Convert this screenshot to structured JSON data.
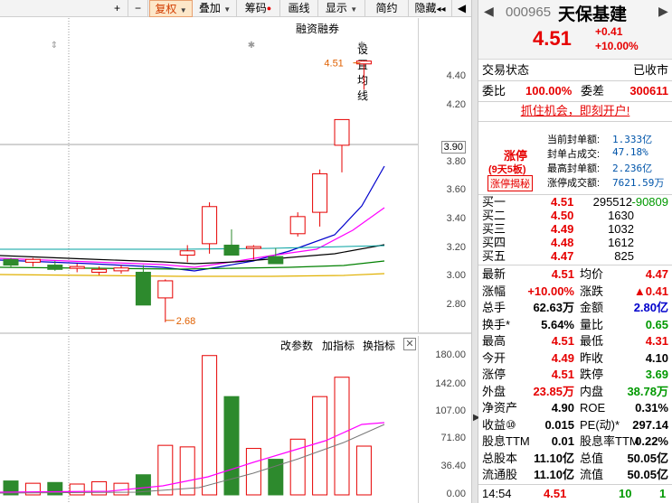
{
  "toolbar": {
    "plus": "+",
    "minus": "−",
    "fuquan": "复权",
    "diejia": "叠加",
    "chouma": "筹码",
    "huaxian": "画线",
    "xianshi": "显示",
    "jianyue": "简约",
    "yincang": "隐藏",
    "collapse": "◂◂",
    "nav": "◀"
  },
  "chart": {
    "link_rzrq": "融资融券",
    "link_setma": "设置均线",
    "price_labels": [
      "4.40",
      "4.20",
      "3.80",
      "3.60",
      "3.40",
      "3.20",
      "3.00",
      "2.80"
    ],
    "current_price_label": "3.90",
    "high_annotation": "4.51",
    "low_annotation": "2.68",
    "vol_links": {
      "params": "改参数",
      "add": "加指标",
      "switch": "换指标",
      "close": "✕"
    },
    "vol_labels": [
      "180.00",
      "142.00",
      "107.00",
      "71.80",
      "36.40",
      "0.00"
    ],
    "colors": {
      "up": "#e60000",
      "down": "#2d8a2d",
      "ma5": "#000000",
      "ma10": "#e0b000",
      "ma20": "#ff00ff",
      "ma30": "#008000",
      "ma60": "#0000cc"
    }
  },
  "chart_data": {
    "type": "candlestick",
    "candles": [
      {
        "o": 3.12,
        "h": 3.13,
        "l": 3.06,
        "c": 3.08,
        "v": 18
      },
      {
        "o": 3.1,
        "h": 3.13,
        "l": 3.07,
        "c": 3.12,
        "v": 15
      },
      {
        "o": 3.08,
        "h": 3.11,
        "l": 3.04,
        "c": 3.05,
        "v": 16
      },
      {
        "o": 3.06,
        "h": 3.09,
        "l": 3.03,
        "c": 3.07,
        "v": 14
      },
      {
        "o": 3.03,
        "h": 3.07,
        "l": 3.01,
        "c": 3.05,
        "v": 17
      },
      {
        "o": 3.04,
        "h": 3.08,
        "l": 3.02,
        "c": 3.06,
        "v": 15
      },
      {
        "o": 3.03,
        "h": 3.08,
        "l": 3.0,
        "c": 2.8,
        "v": 26
      },
      {
        "o": 2.85,
        "h": 2.98,
        "l": 2.68,
        "c": 2.97,
        "v": 64
      },
      {
        "o": 3.15,
        "h": 3.22,
        "l": 3.1,
        "c": 3.18,
        "v": 62
      },
      {
        "o": 3.23,
        "h": 3.52,
        "l": 3.16,
        "c": 3.49,
        "v": 180
      },
      {
        "o": 3.22,
        "h": 3.33,
        "l": 3.16,
        "c": 3.15,
        "v": 127
      },
      {
        "o": 3.2,
        "h": 3.22,
        "l": 3.12,
        "c": 3.21,
        "v": 60
      },
      {
        "o": 3.14,
        "h": 3.2,
        "l": 3.1,
        "c": 3.09,
        "v": 46
      },
      {
        "o": 3.3,
        "h": 3.45,
        "l": 3.28,
        "c": 3.42,
        "v": 72
      },
      {
        "o": 3.45,
        "h": 3.75,
        "l": 3.35,
        "c": 3.72,
        "v": 127
      },
      {
        "o": 3.92,
        "h": 4.1,
        "l": 3.73,
        "c": 4.1,
        "v": 152
      },
      {
        "o": 4.49,
        "h": 4.51,
        "l": 4.31,
        "c": 4.51,
        "v": 63
      }
    ]
  },
  "panel": {
    "code": "000965",
    "name": "天保基建",
    "price": "4.51",
    "change": "+0.41",
    "change_pct": "+10.00%",
    "status_label": "交易状态",
    "status_value": "已收市",
    "weibi_label": "委比",
    "weibi_value": "100.00%",
    "weicha_label": "委差",
    "weicha_value": "300611",
    "promo": "抓住机会，即刻开户!",
    "zt_title": "涨停",
    "zt_sub": "(9天5板)",
    "zt_btn": "涨停揭秘",
    "zt_rows": [
      {
        "label": "当前封单额:",
        "value": "1.333亿"
      },
      {
        "label": "封单占成交:",
        "value": "47.18%"
      },
      {
        "label": "最高封单额:",
        "value": "2.236亿"
      },
      {
        "label": "涨停成交额:",
        "value": "7621.59万"
      }
    ],
    "bids": [
      {
        "label": "买一",
        "price": "4.51",
        "vol": "295512",
        "extra": "-90809"
      },
      {
        "label": "买二",
        "price": "4.50",
        "vol": "1630",
        "extra": ""
      },
      {
        "label": "买三",
        "price": "4.49",
        "vol": "1032",
        "extra": ""
      },
      {
        "label": "买四",
        "price": "4.48",
        "vol": "1612",
        "extra": ""
      },
      {
        "label": "买五",
        "price": "4.47",
        "vol": "825",
        "extra": ""
      }
    ],
    "stats": [
      {
        "l1": "最新",
        "v1": "4.51",
        "c1": "red",
        "l2": "均价",
        "v2": "4.47",
        "c2": "red"
      },
      {
        "l1": "涨幅",
        "v1": "+10.00%",
        "c1": "red",
        "l2": "涨跌",
        "v2": "▲0.41",
        "c2": "red"
      },
      {
        "l1": "总手",
        "v1": "62.63万",
        "c1": "",
        "l2": "金额",
        "v2": "2.80亿",
        "c2": "blue"
      },
      {
        "l1": "换手*",
        "v1": "5.64%",
        "c1": "",
        "l2": "量比",
        "v2": "0.65",
        "c2": "green"
      },
      {
        "l1": "最高",
        "v1": "4.51",
        "c1": "red",
        "l2": "最低",
        "v2": "4.31",
        "c2": "red"
      },
      {
        "l1": "今开",
        "v1": "4.49",
        "c1": "red",
        "l2": "昨收",
        "v2": "4.10",
        "c2": ""
      },
      {
        "l1": "涨停",
        "v1": "4.51",
        "c1": "red",
        "l2": "跌停",
        "v2": "3.69",
        "c2": "green"
      },
      {
        "l1": "外盘",
        "v1": "23.85万",
        "c1": "red",
        "l2": "内盘",
        "v2": "38.78万",
        "c2": "green"
      },
      {
        "l1": "净资产",
        "v1": "4.90",
        "c1": "",
        "l2": "ROE",
        "v2": "0.31%",
        "c2": ""
      },
      {
        "l1": "收益⑩",
        "v1": "0.015",
        "c1": "",
        "l2": "PE(动)*",
        "v2": "297.14",
        "c2": ""
      },
      {
        "l1": "股息TTM",
        "v1": "0.01",
        "c1": "",
        "l2": "股息率TTM",
        "v2": "0.22%",
        "c2": ""
      },
      {
        "l1": "总股本",
        "v1": "11.10亿",
        "c1": "",
        "l2": "总值",
        "v2": "50.05亿",
        "c2": ""
      },
      {
        "l1": "流通股",
        "v1": "11.10亿",
        "c1": "",
        "l2": "流值",
        "v2": "50.05亿",
        "c2": ""
      }
    ],
    "tick": {
      "time": "14:54",
      "price": "4.51",
      "vol": "10",
      "dir": "1"
    }
  }
}
